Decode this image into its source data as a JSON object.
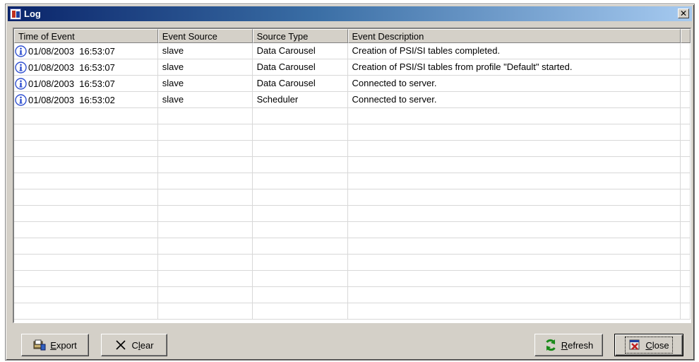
{
  "window": {
    "title": "Log",
    "close_glyph": "✕"
  },
  "log": {
    "columns": [
      "Time of Event",
      "Event Source",
      "Source Type",
      "Event Description"
    ],
    "rows": [
      {
        "icon": "info-icon",
        "time": "01/08/2003  16:53:07",
        "source": "slave",
        "type": "Data Carousel",
        "description": "Creation of PSI/SI tables completed."
      },
      {
        "icon": "info-icon",
        "time": "01/08/2003  16:53:07",
        "source": "slave",
        "type": "Data Carousel",
        "description": "Creation of PSI/SI tables from profile \"Default\" started."
      },
      {
        "icon": "info-icon",
        "time": "01/08/2003  16:53:07",
        "source": "slave",
        "type": "Data Carousel",
        "description": "Connected to server."
      },
      {
        "icon": "info-icon",
        "time": "01/08/2003  16:53:02",
        "source": "slave",
        "type": "Scheduler",
        "description": "Connected to server."
      }
    ]
  },
  "buttons": {
    "export": {
      "mnemonic": "E",
      "rest": "xport",
      "icon": "export-icon"
    },
    "clear": {
      "mnemonic": "l",
      "prefix": "C",
      "rest": "ear",
      "icon": "clear-x-icon"
    },
    "refresh": {
      "mnemonic": "R",
      "rest": "efresh",
      "icon": "refresh-icon"
    },
    "close": {
      "mnemonic": "C",
      "rest": "lose",
      "icon": "close-icon"
    }
  },
  "colors": {
    "titlebar_start": "#0a246a",
    "titlebar_end": "#a6caf0",
    "face": "#d4d0c8",
    "info_icon": "#3050d0"
  }
}
